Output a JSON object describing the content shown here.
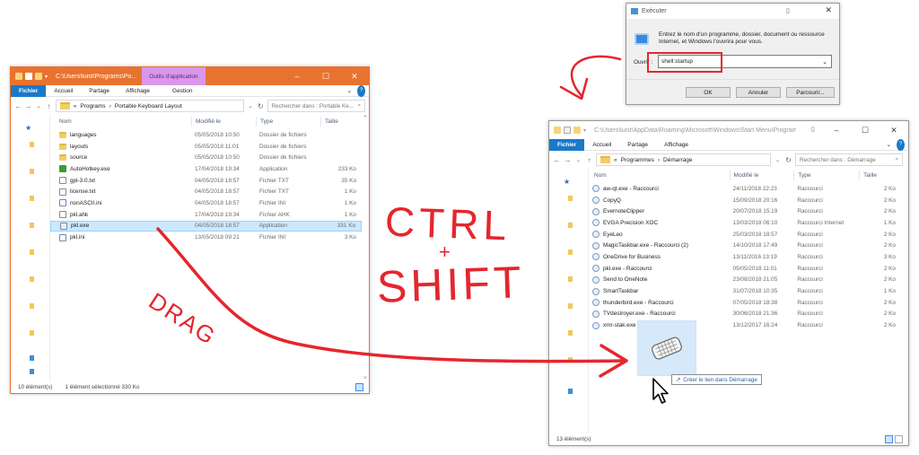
{
  "left_window": {
    "title": "C:\\Users\\luist\\Programs\\Po...",
    "context_tab": "Outils d'application",
    "ribbon": {
      "file": "Fichier",
      "home": "Accueil",
      "share": "Partage",
      "view": "Affichage",
      "manage": "Gestion",
      "help": "?"
    },
    "breadcrumb": {
      "prefix": "«",
      "part1": "Programs",
      "sep": "›",
      "part2": "Portable Keyboard Layout"
    },
    "search_placeholder": "Rechercher dans : Portable Ke...",
    "columns": {
      "name": "Nom",
      "date": "Modifié le",
      "type": "Type",
      "size": "Taille"
    },
    "files": [
      {
        "icon": "folder",
        "name": "languages",
        "date": "05/05/2018 10:50",
        "type": "Dossier de fichiers",
        "size": ""
      },
      {
        "icon": "folder",
        "name": "layouts",
        "date": "05/05/2018 11:01",
        "type": "Dossier de fichiers",
        "size": ""
      },
      {
        "icon": "folder",
        "name": "source",
        "date": "05/05/2018 10:50",
        "type": "Dossier de fichiers",
        "size": ""
      },
      {
        "icon": "ahk",
        "name": "AutoHotkey.exe",
        "date": "17/04/2018 19:34",
        "type": "Application",
        "size": "233 Ko"
      },
      {
        "icon": "txt",
        "name": "gpl-3.0.txt",
        "date": "04/05/2018 18:57",
        "type": "Fichier TXT",
        "size": "35 Ko"
      },
      {
        "icon": "txt",
        "name": "license.txt",
        "date": "04/05/2018 18:57",
        "type": "Fichier TXT",
        "size": "1 Ko"
      },
      {
        "icon": "ini",
        "name": "nonASCII.ini",
        "date": "04/05/2018 18:57",
        "type": "Fichier INI",
        "size": "1 Ko"
      },
      {
        "icon": "txt",
        "name": "pkl.ahk",
        "date": "17/04/2018 19:34",
        "type": "Fichier AHK",
        "size": "1 Ko"
      },
      {
        "icon": "exe",
        "name": "pkl.exe",
        "date": "04/05/2018 18:57",
        "type": "Application",
        "size": "331 Ko"
      },
      {
        "icon": "ini",
        "name": "pkl.ini",
        "date": "13/05/2018 09:21",
        "type": "Fichier INI",
        "size": "3 Ko"
      }
    ],
    "status_count": "10 élément(s)",
    "status_selected": "1 élément sélectionné 330 Ko"
  },
  "run_dialog": {
    "title": "Exécuter",
    "description": "Entrez le nom d'un programme, dossier, document ou ressource Internet, et Windows l'ouvrira pour vous.",
    "open_label": "Ouvrir :",
    "input_value": "shell:startup",
    "ok": "OK",
    "cancel": "Annuler",
    "browse": "Parcourir..."
  },
  "right_window": {
    "title": "C:\\Users\\luist\\AppData\\Roaming\\Microsoft\\Windows\\Start Menu\\Programs\\St...",
    "ribbon": {
      "file": "Fichier",
      "home": "Accueil",
      "share": "Partage",
      "view": "Affichage",
      "help": "?"
    },
    "breadcrumb": {
      "prefix": "«",
      "part1": "Programmes",
      "sep": "›",
      "part2": "Démarrage"
    },
    "search_placeholder": "Rechercher dans : Démarrage",
    "columns": {
      "name": "Nom",
      "date": "Modifié le",
      "type": "Type",
      "size": "Taille"
    },
    "files": [
      {
        "name": "aw-qt.exe - Raccourci",
        "date": "24/11/2018 22:23",
        "type": "Raccourci",
        "size": "2 Ko"
      },
      {
        "name": "CopyQ",
        "date": "15/09/2018 20:16",
        "type": "Raccourci",
        "size": "2 Ko"
      },
      {
        "name": "EvernoteClipper",
        "date": "20/07/2018 15:19",
        "type": "Raccourci",
        "size": "2 Ko"
      },
      {
        "name": "EVGA Precision XOC",
        "date": "13/03/2018 06:10",
        "type": "Raccourci Internet",
        "size": "1 Ko"
      },
      {
        "name": "EyeLeo",
        "date": "25/03/2018 18:57",
        "type": "Raccourci",
        "size": "2 Ko"
      },
      {
        "name": "MagicTaskbar.exe - Raccourci (2)",
        "date": "14/10/2018 17:49",
        "type": "Raccourci",
        "size": "2 Ko"
      },
      {
        "name": "OneDrive for Business",
        "date": "13/11/2016 13:19",
        "type": "Raccourci",
        "size": "3 Ko"
      },
      {
        "name": "pkl.exe - Raccourci",
        "date": "05/05/2018 11:01",
        "type": "Raccourci",
        "size": "2 Ko"
      },
      {
        "name": "Send to OneNote",
        "date": "23/08/2018 21:05",
        "type": "Raccourci",
        "size": "2 Ko"
      },
      {
        "name": "SmartTaskbar",
        "date": "31/07/2018 10:35",
        "type": "Raccourci",
        "size": "1 Ko"
      },
      {
        "name": "thunderbird.exe - Raccourci",
        "date": "07/05/2018 18:38",
        "type": "Raccourci",
        "size": "2 Ko"
      },
      {
        "name": "TVdestroyer.exe - Raccourci",
        "date": "30/06/2018 21:36",
        "type": "Raccourci",
        "size": "2 Ko"
      },
      {
        "name": "xmr-stak.exe",
        "date": "13/12/2017 16:24",
        "type": "Raccourci",
        "size": "2 Ko"
      }
    ],
    "drag_tooltip": "Créer le lien dans Démarrage",
    "status_count": "13 élément(s)"
  },
  "annotations": {
    "ctrl": "CTRL",
    "plus": "+",
    "shift": "SHIFT",
    "drag": "DRAG"
  },
  "colors": {
    "accent": "#1979ca",
    "annotation": "#e5262d",
    "title_orange": "#e8732f",
    "selection": "#cce8ff"
  },
  "icons": [
    "folder-icon",
    "back-arrow-icon",
    "forward-arrow-icon",
    "up-arrow-icon",
    "refresh-icon",
    "search-icon",
    "minimize-icon",
    "maximize-icon",
    "close-icon",
    "run-icon",
    "cursor-icon",
    "keyboard-icon"
  ]
}
